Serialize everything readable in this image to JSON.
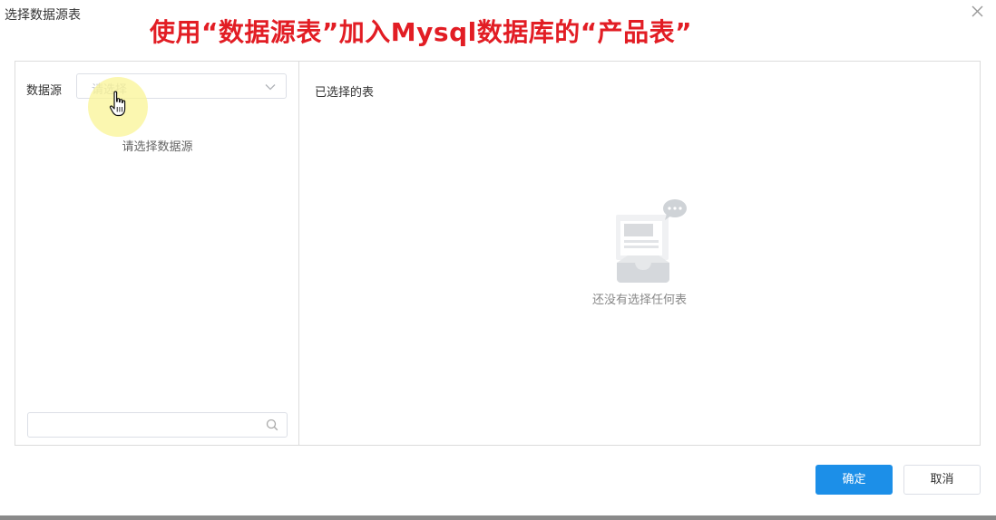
{
  "dialog": {
    "title": "选择数据源表",
    "annotation": "使用“数据源表”加入Mysql数据库的“产品表”"
  },
  "left_pane": {
    "datasource_label": "数据源",
    "select_placeholder": "请选择",
    "empty_hint": "请选择数据源",
    "search_placeholder": ""
  },
  "right_pane": {
    "title": "已选择的表",
    "empty_text": "还没有选择任何表"
  },
  "footer": {
    "confirm_label": "确定",
    "cancel_label": "取消"
  },
  "icons": {
    "close": "close-icon",
    "select_arrow": "chevron-down-icon",
    "search": "search-icon",
    "cursor": "hand-cursor-icon",
    "empty": "empty-inbox-illustration"
  },
  "colors": {
    "annotation": "#e21d24",
    "primary": "#1c8fe8",
    "border": "#dcdcdc"
  }
}
